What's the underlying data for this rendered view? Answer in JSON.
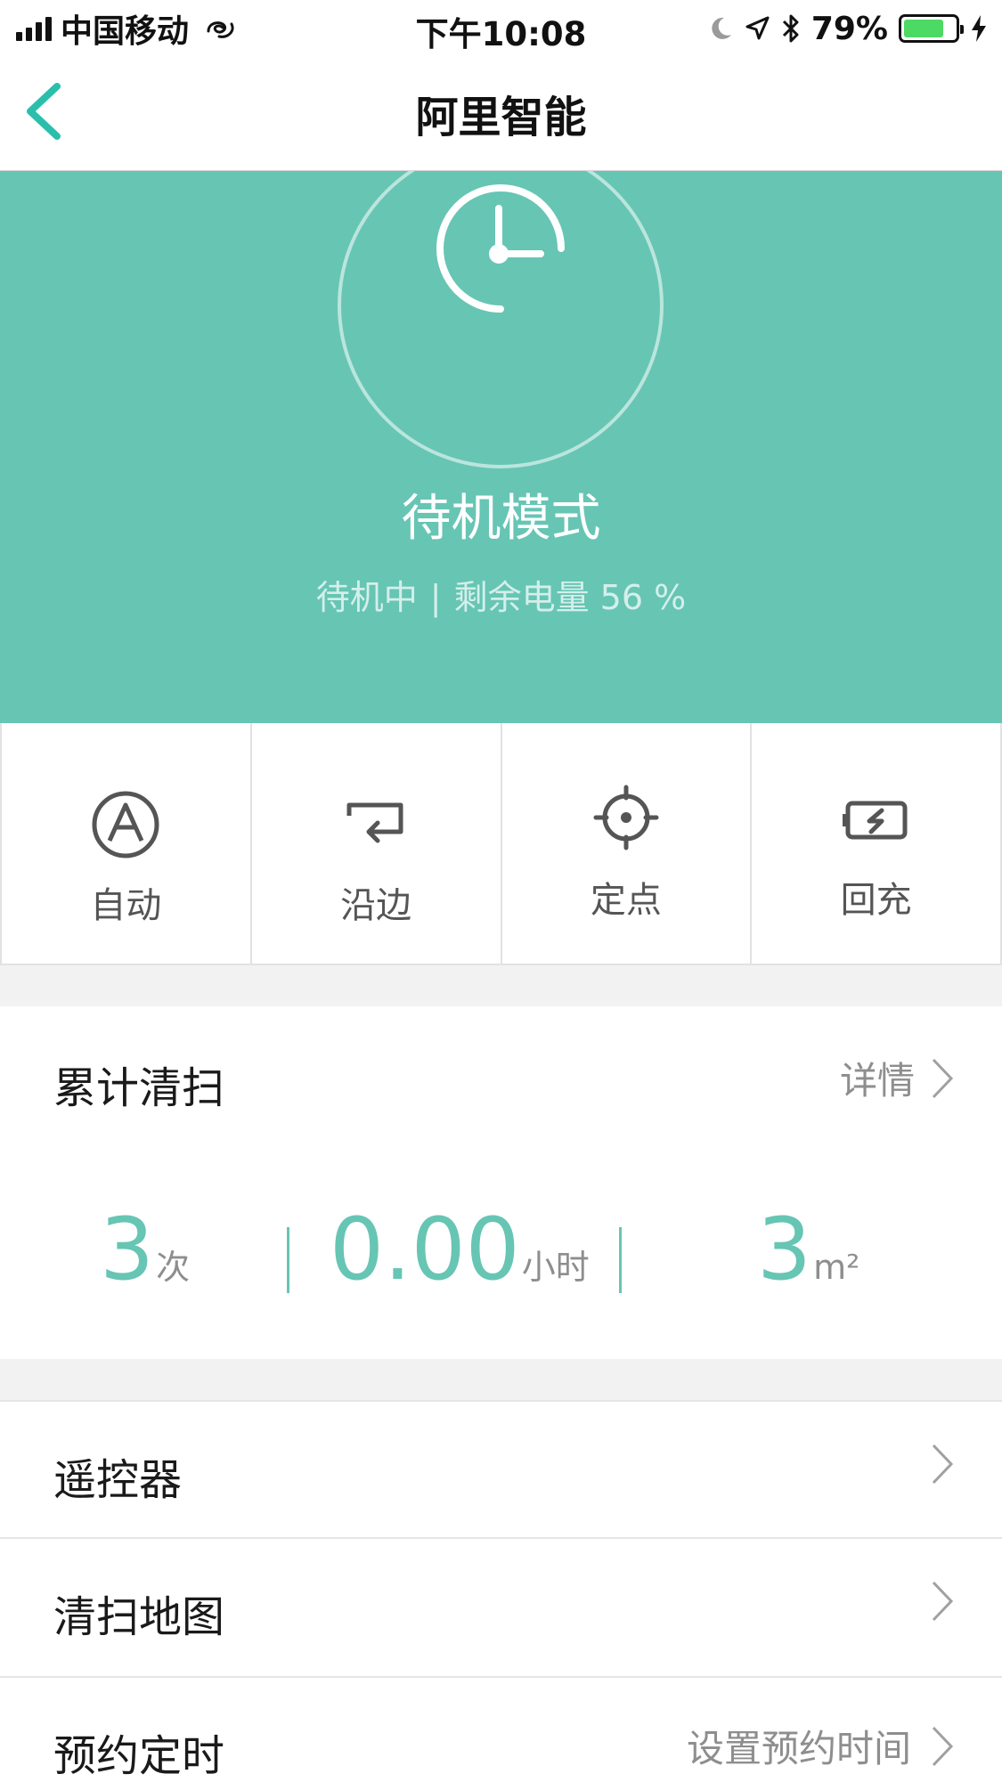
{
  "status_bar": {
    "carrier": "中国移动",
    "time": "下午10:08",
    "battery_percent": "79%",
    "battery_level": 0.79
  },
  "nav": {
    "title": "阿里智能"
  },
  "hero": {
    "mode_title": "待机模式",
    "status_text": "待机中",
    "separator": "|",
    "battery_text": "剩余电量 56 %",
    "background_color": "#67c5b4"
  },
  "modes": [
    {
      "label": "自动",
      "icon": "auto-mode-icon"
    },
    {
      "label": "沿边",
      "icon": "edge-mode-icon"
    },
    {
      "label": "定点",
      "icon": "spot-mode-icon"
    },
    {
      "label": "回充",
      "icon": "recharge-icon"
    }
  ],
  "stats": {
    "title": "累计清扫",
    "detail_label": "详情",
    "count": {
      "value": "3",
      "unit": "次"
    },
    "duration": {
      "value": "0.00",
      "unit": "小时"
    },
    "area": {
      "value": "3",
      "unit": "m²"
    },
    "accent_color": "#67c5b4"
  },
  "list": {
    "remote": {
      "label": "遥控器"
    },
    "map": {
      "label": "清扫地图"
    },
    "schedule": {
      "label": "预约定时",
      "value": "设置预约时间"
    }
  }
}
